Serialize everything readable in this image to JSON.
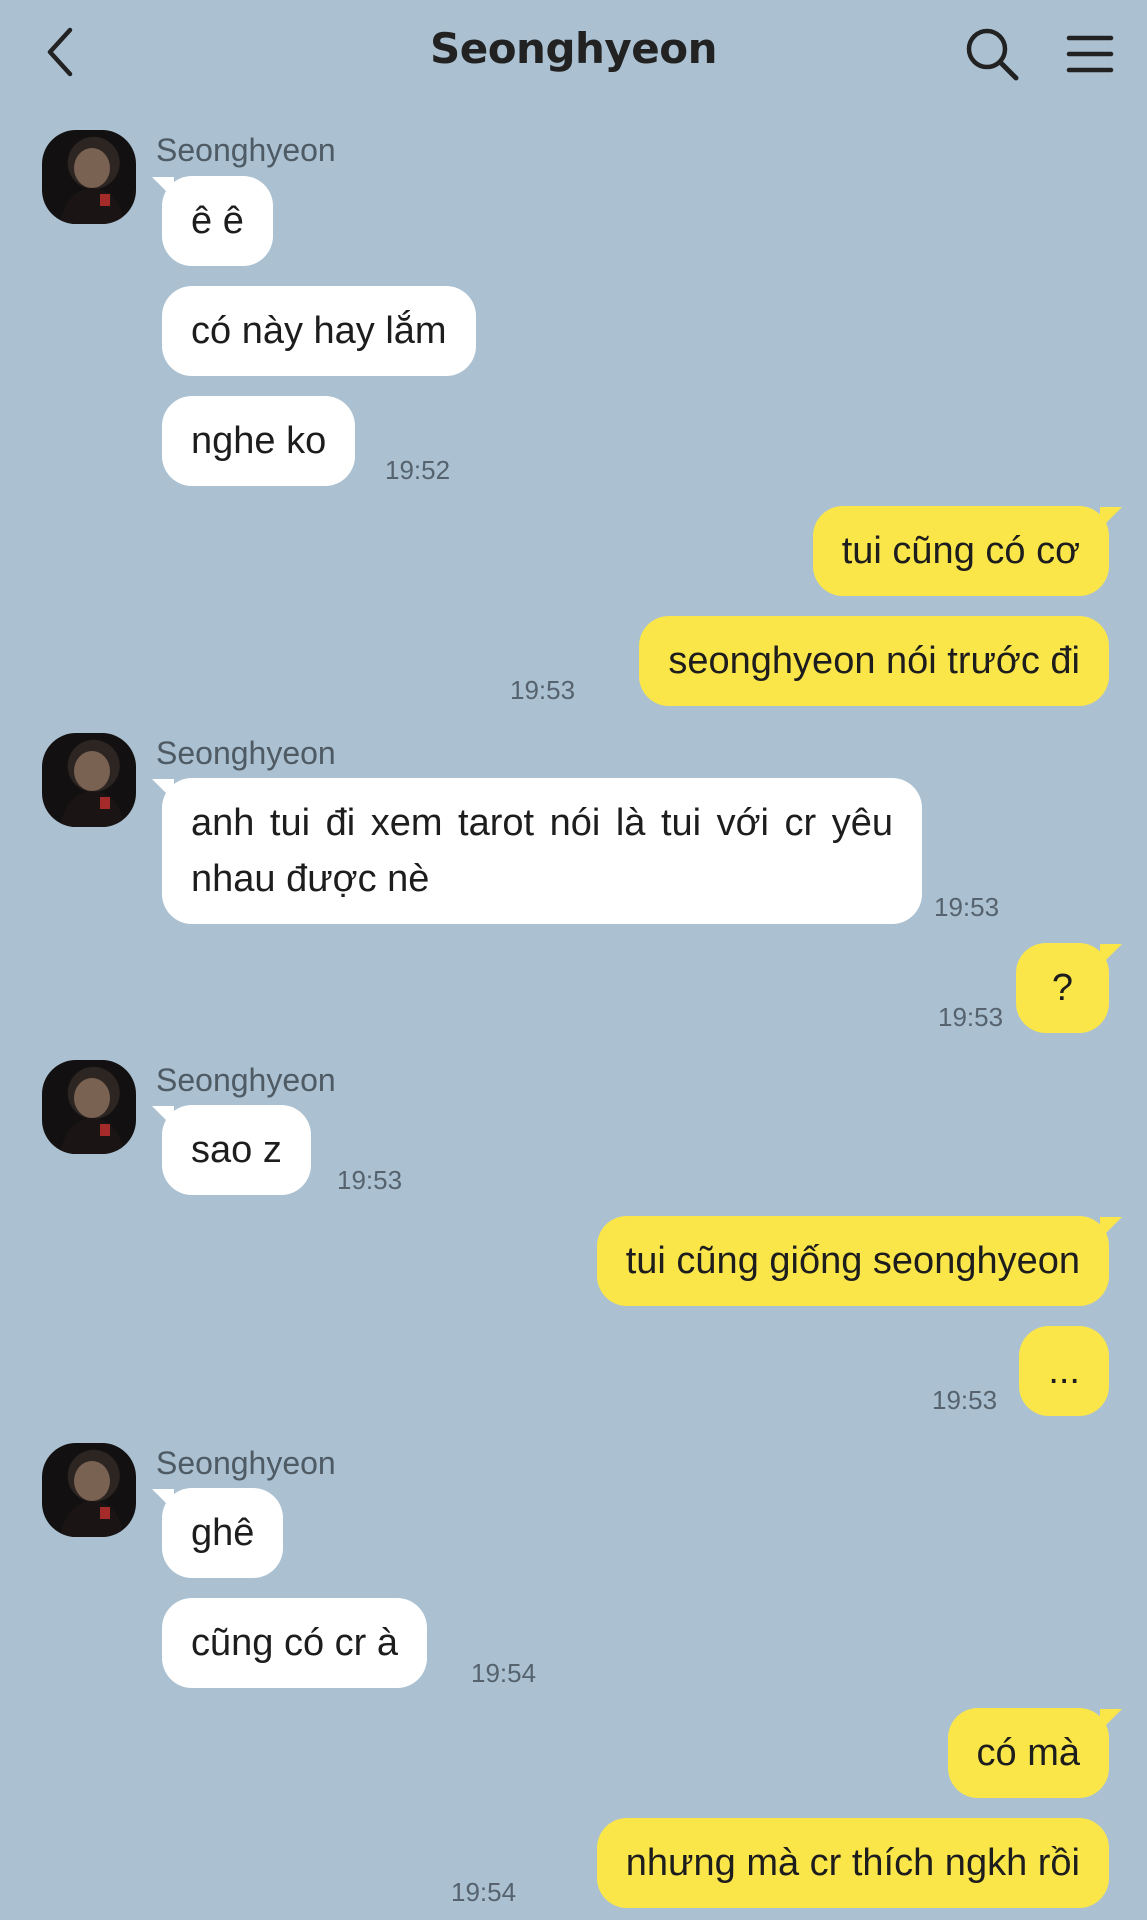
{
  "header": {
    "title": "Seonghyeon",
    "back_icon": "chevron-left-icon",
    "search_icon": "search-icon",
    "menu_icon": "hamburger-menu-icon"
  },
  "colors": {
    "background": "#abc1d1",
    "incoming_bubble": "#ffffff",
    "outgoing_bubble": "#fbe64a"
  },
  "messages": {
    "g1": {
      "sender": "Seonghyeon",
      "m1": "ê ê",
      "m2": "có này hay lắm",
      "m3": "nghe ko",
      "time": "19:52"
    },
    "g2": {
      "m1": "tui cũng có cơ",
      "m2": "seonghyeon nói trước đi",
      "time": "19:53"
    },
    "g3": {
      "sender": "Seonghyeon",
      "m1": "anh tui đi xem tarot nói là tui với cr yêu nhau được nè",
      "time": "19:53"
    },
    "g4": {
      "m1": "?",
      "time": "19:53"
    },
    "g5": {
      "sender": "Seonghyeon",
      "m1": "sao z",
      "time": "19:53"
    },
    "g6": {
      "m1": "tui cũng giống seonghyeon",
      "m2": "...",
      "time": "19:53"
    },
    "g7": {
      "sender": "Seonghyeon",
      "m1": "ghê",
      "m2": "cũng có cr à",
      "time": "19:54"
    },
    "g8": {
      "m1": "có mà",
      "m2": "nhưng mà cr thích ngkh rồi",
      "time": "19:54"
    }
  }
}
